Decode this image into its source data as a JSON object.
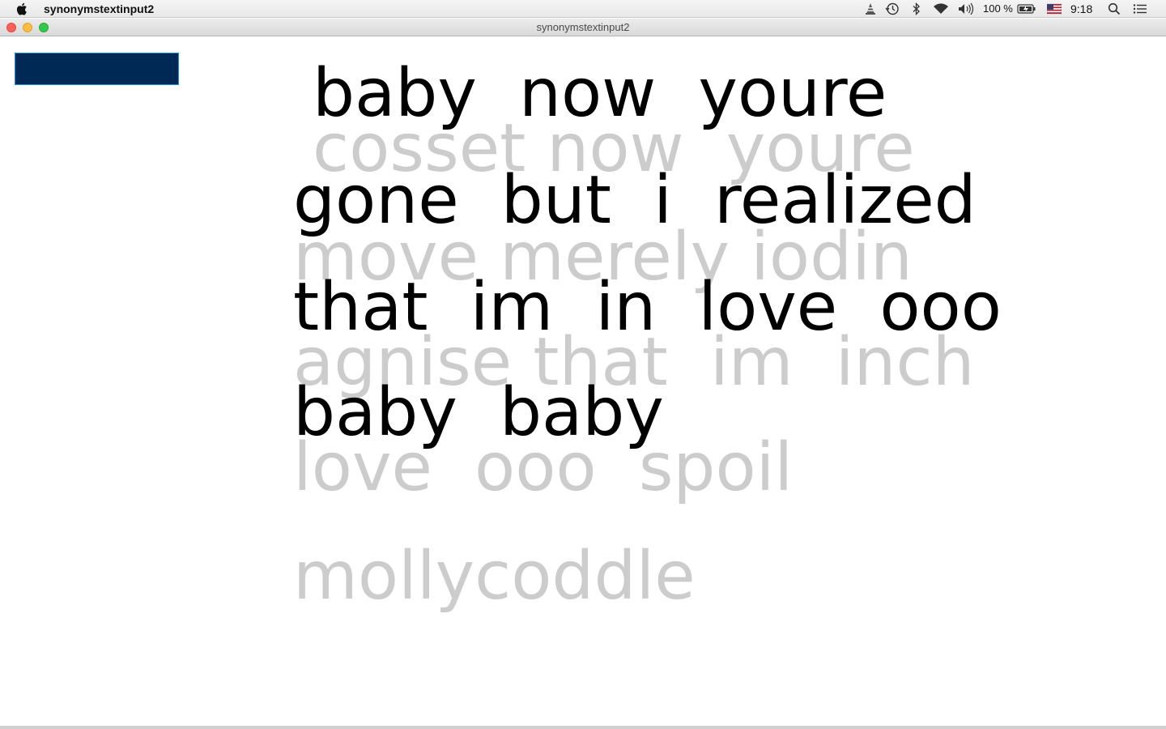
{
  "menubar": {
    "app_name": "synonymstextinput2",
    "battery": "100 %",
    "clock": "9:18",
    "icons": [
      "apple-icon",
      "vlc-cone-icon",
      "time-machine-icon",
      "bluetooth-icon",
      "wifi-icon",
      "volume-icon",
      "battery-icon",
      "us-flag-icon",
      "spotlight-icon",
      "notification-center-icon"
    ]
  },
  "window": {
    "title": "synonymstextinput2"
  },
  "input": {
    "value": "",
    "background": "#002a55",
    "border": "#1f8fd0"
  },
  "lyrics": [
    "baby  now  youre",
    "gone  but  i  realized",
    "that  im  in  love  ooo",
    "baby  baby"
  ],
  "synonyms": [
    "cosset now  youre",
    "move merely iodin",
    "agnise that  im  inch",
    "love  ooo  spoil",
    "mollycoddle"
  ],
  "colors": {
    "lyric": "#000000",
    "synonym": "#cccccc"
  }
}
